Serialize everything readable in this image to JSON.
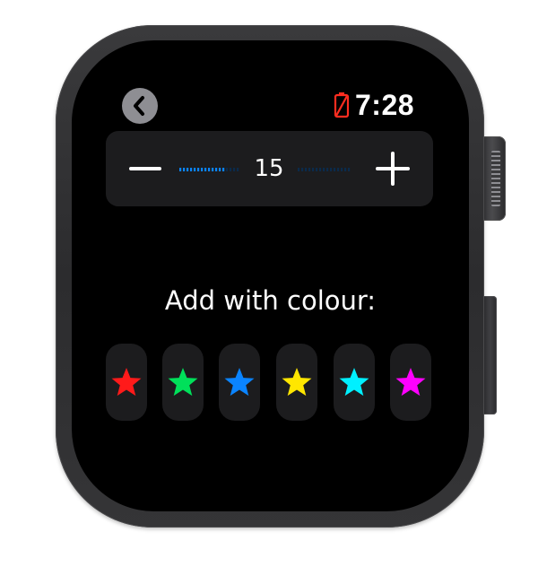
{
  "status": {
    "time": "7:28",
    "battery_icon": "battery-warning-icon",
    "battery_color": "#ff2d20",
    "back_icon": "chevron-left-icon"
  },
  "stepper": {
    "value": "15",
    "minus_icon": "minus-icon",
    "plus_icon": "plus-icon",
    "fill_fraction": 0.27,
    "accent": "#0a84ff"
  },
  "prompt": "Add with colour:",
  "colours": [
    {
      "name": "red",
      "hex": "#ff1a1a",
      "icon": "star-icon"
    },
    {
      "name": "green",
      "hex": "#00e05a",
      "icon": "star-icon"
    },
    {
      "name": "blue",
      "hex": "#0a84ff",
      "icon": "star-icon"
    },
    {
      "name": "yellow",
      "hex": "#ffe600",
      "icon": "star-icon"
    },
    {
      "name": "cyan",
      "hex": "#00f0ff",
      "icon": "star-icon"
    },
    {
      "name": "magenta",
      "hex": "#ff00ff",
      "icon": "star-icon"
    }
  ]
}
